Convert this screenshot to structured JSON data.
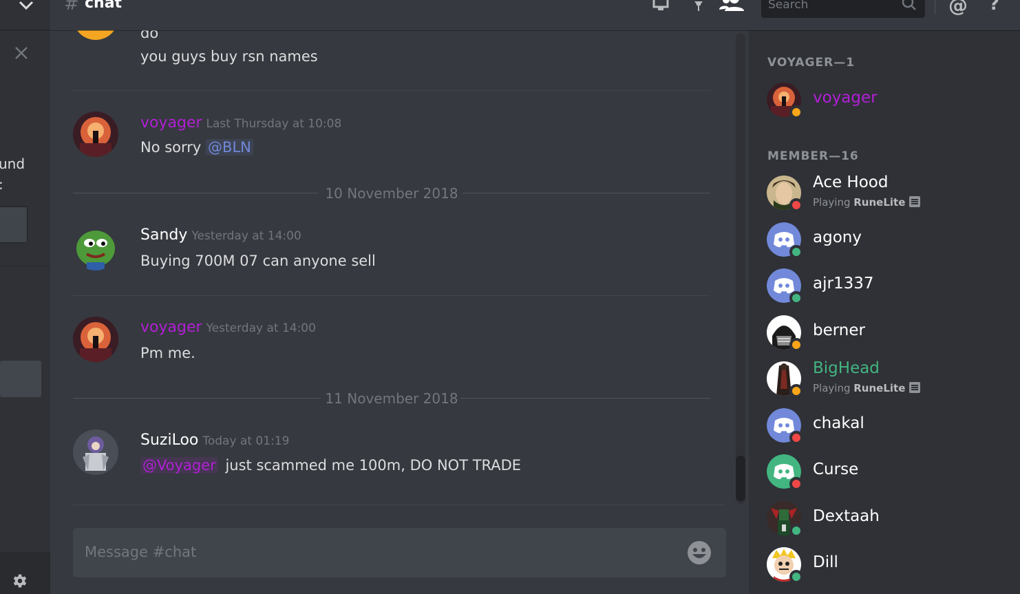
{
  "header": {
    "hash": "#",
    "channel": "chat",
    "search_placeholder": "Search",
    "at_symbol": "@",
    "help_symbol": "?"
  },
  "sidebar": {
    "partial_text_1": "und",
    "partial_text_2": ":"
  },
  "messages": [
    {
      "lines": [
        "do",
        "you guys buy rsn names"
      ]
    },
    {
      "author": "voyager",
      "author_color": "#b21fd6",
      "timestamp": "Last Thursday at 10:08",
      "text": "No sorry",
      "mention": "@BLN"
    },
    {
      "date_divider": "10 November 2018"
    },
    {
      "author": "Sandy",
      "author_color": "#ffffff",
      "timestamp": "Yesterday at 14:00",
      "text": "Buying 700M 07 can anyone sell"
    },
    {
      "author": "voyager",
      "author_color": "#b21fd6",
      "timestamp": "Yesterday at 14:00",
      "text": "Pm me."
    },
    {
      "date_divider": "11 November 2018"
    },
    {
      "author": "SuziLoo",
      "author_color": "#ffffff",
      "timestamp": "Today at 01:19",
      "mention": "@Voyager",
      "text": "just scammed me 100m, DO NOT TRADE"
    }
  ],
  "composer": {
    "placeholder": "Message #chat"
  },
  "members": {
    "voyager_header": "VOYAGER—1",
    "member_header": "MEMBER—16",
    "voyager_list": [
      {
        "name": "voyager",
        "color": "#b21fd6",
        "status": "idle"
      }
    ],
    "member_list": [
      {
        "name": "Ace Hood",
        "color": "#ffffff",
        "status": "dnd",
        "activity_prefix": "Playing ",
        "activity": "RuneLite"
      },
      {
        "name": "agony",
        "color": "#ffffff",
        "status": "online"
      },
      {
        "name": "ajr1337",
        "color": "#ffffff",
        "status": "online"
      },
      {
        "name": "berner",
        "color": "#ffffff",
        "status": "idle"
      },
      {
        "name": "BigHead",
        "color": "#43b581",
        "status": "idle",
        "activity_prefix": "Playing ",
        "activity": "RuneLite"
      },
      {
        "name": "chakal",
        "color": "#ffffff",
        "status": "dnd"
      },
      {
        "name": "Curse",
        "color": "#ffffff",
        "status": "dnd"
      },
      {
        "name": "Dextaah",
        "color": "#ffffff",
        "status": "online"
      },
      {
        "name": "Dill",
        "color": "#ffffff",
        "status": "online"
      }
    ]
  },
  "colors": {
    "background": "#36393f",
    "sidebar": "#2f3136",
    "online": "#43b581",
    "idle": "#faa61a",
    "dnd": "#f04747",
    "blurple": "#7289da",
    "mention_blue": "#7289da",
    "voyager_purple": "#b21fd6"
  },
  "icons": [
    "chevron-down-icon",
    "close-icon",
    "settings-gear-icon",
    "pin-icon",
    "notification-bell-icon",
    "member-list-icon",
    "search-icon",
    "mention-icon",
    "help-icon",
    "emoji-icon"
  ]
}
